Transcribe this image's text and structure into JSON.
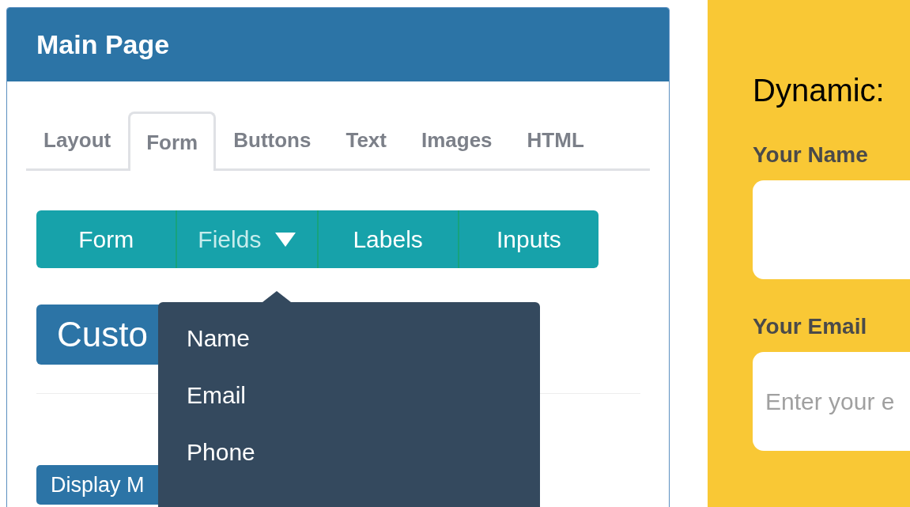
{
  "panel": {
    "title": "Main Page"
  },
  "tabs": [
    {
      "label": "Layout",
      "selected": false
    },
    {
      "label": "Form",
      "selected": true
    },
    {
      "label": "Buttons",
      "selected": false
    },
    {
      "label": "Text",
      "selected": false
    },
    {
      "label": "Images",
      "selected": false
    },
    {
      "label": "HTML",
      "selected": false
    }
  ],
  "toolbar": [
    {
      "label": "Form",
      "expanded": false,
      "dropdown": false
    },
    {
      "label": "Fields",
      "expanded": true,
      "dropdown": true
    },
    {
      "label": "Labels",
      "expanded": false,
      "dropdown": false
    },
    {
      "label": "Inputs",
      "expanded": false,
      "dropdown": false
    }
  ],
  "dropdown_menu": [
    {
      "label": "Name"
    },
    {
      "label": "Email"
    },
    {
      "label": "Phone"
    }
  ],
  "heading_badge": "Custo",
  "small_badge": "Display M",
  "preview": {
    "title": "Dynamic:",
    "fields": [
      {
        "label": "Your Name"
      },
      {
        "label": "Your Email",
        "placeholder": "Enter your e"
      }
    ]
  }
}
